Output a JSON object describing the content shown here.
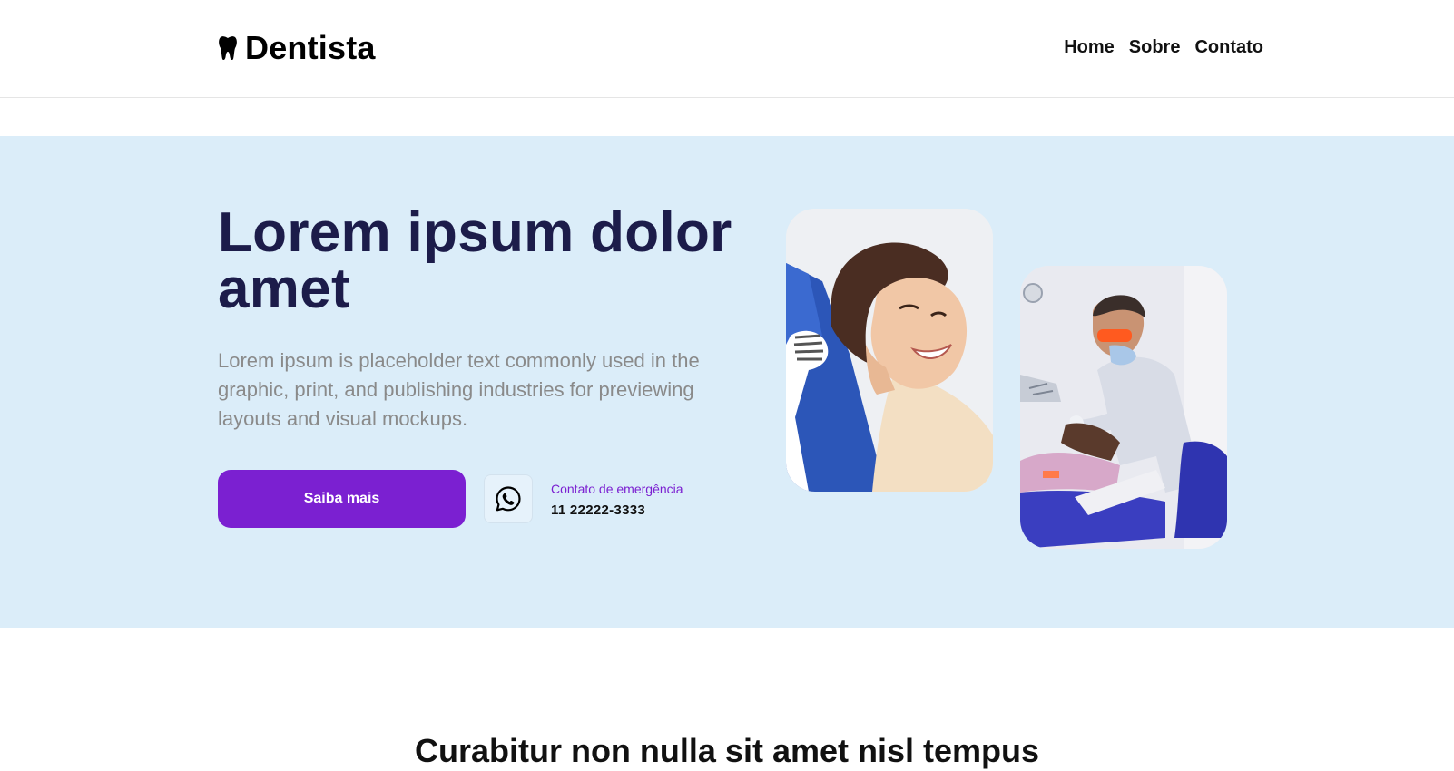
{
  "header": {
    "brand_name": "Dentista",
    "brand_icon": "tooth-icon",
    "nav": [
      {
        "label": "Home"
      },
      {
        "label": "Sobre"
      },
      {
        "label": "Contato"
      }
    ]
  },
  "hero": {
    "title": "Lorem ipsum dolor amet",
    "lead": "Lorem ipsum is placeholder text commonly used in the graphic, print, and publishing industries for previewing layouts and visual mockups.",
    "cta_label": "Saiba mais",
    "contact_icon": "whatsapp-icon",
    "contact_label": "Contato de emergência",
    "contact_phone": "11 22222-3333",
    "images": [
      {
        "subject": "smiling-patient-photo"
      },
      {
        "subject": "dentist-treating-patient-photo"
      }
    ]
  },
  "next_section": {
    "title": "Curabitur non nulla sit amet nisl tempus"
  },
  "colors": {
    "hero_background": "#dbedf9",
    "title_color": "#1c1c4a",
    "accent": "#7b20d1",
    "lead_text": "#8a8a8a"
  }
}
